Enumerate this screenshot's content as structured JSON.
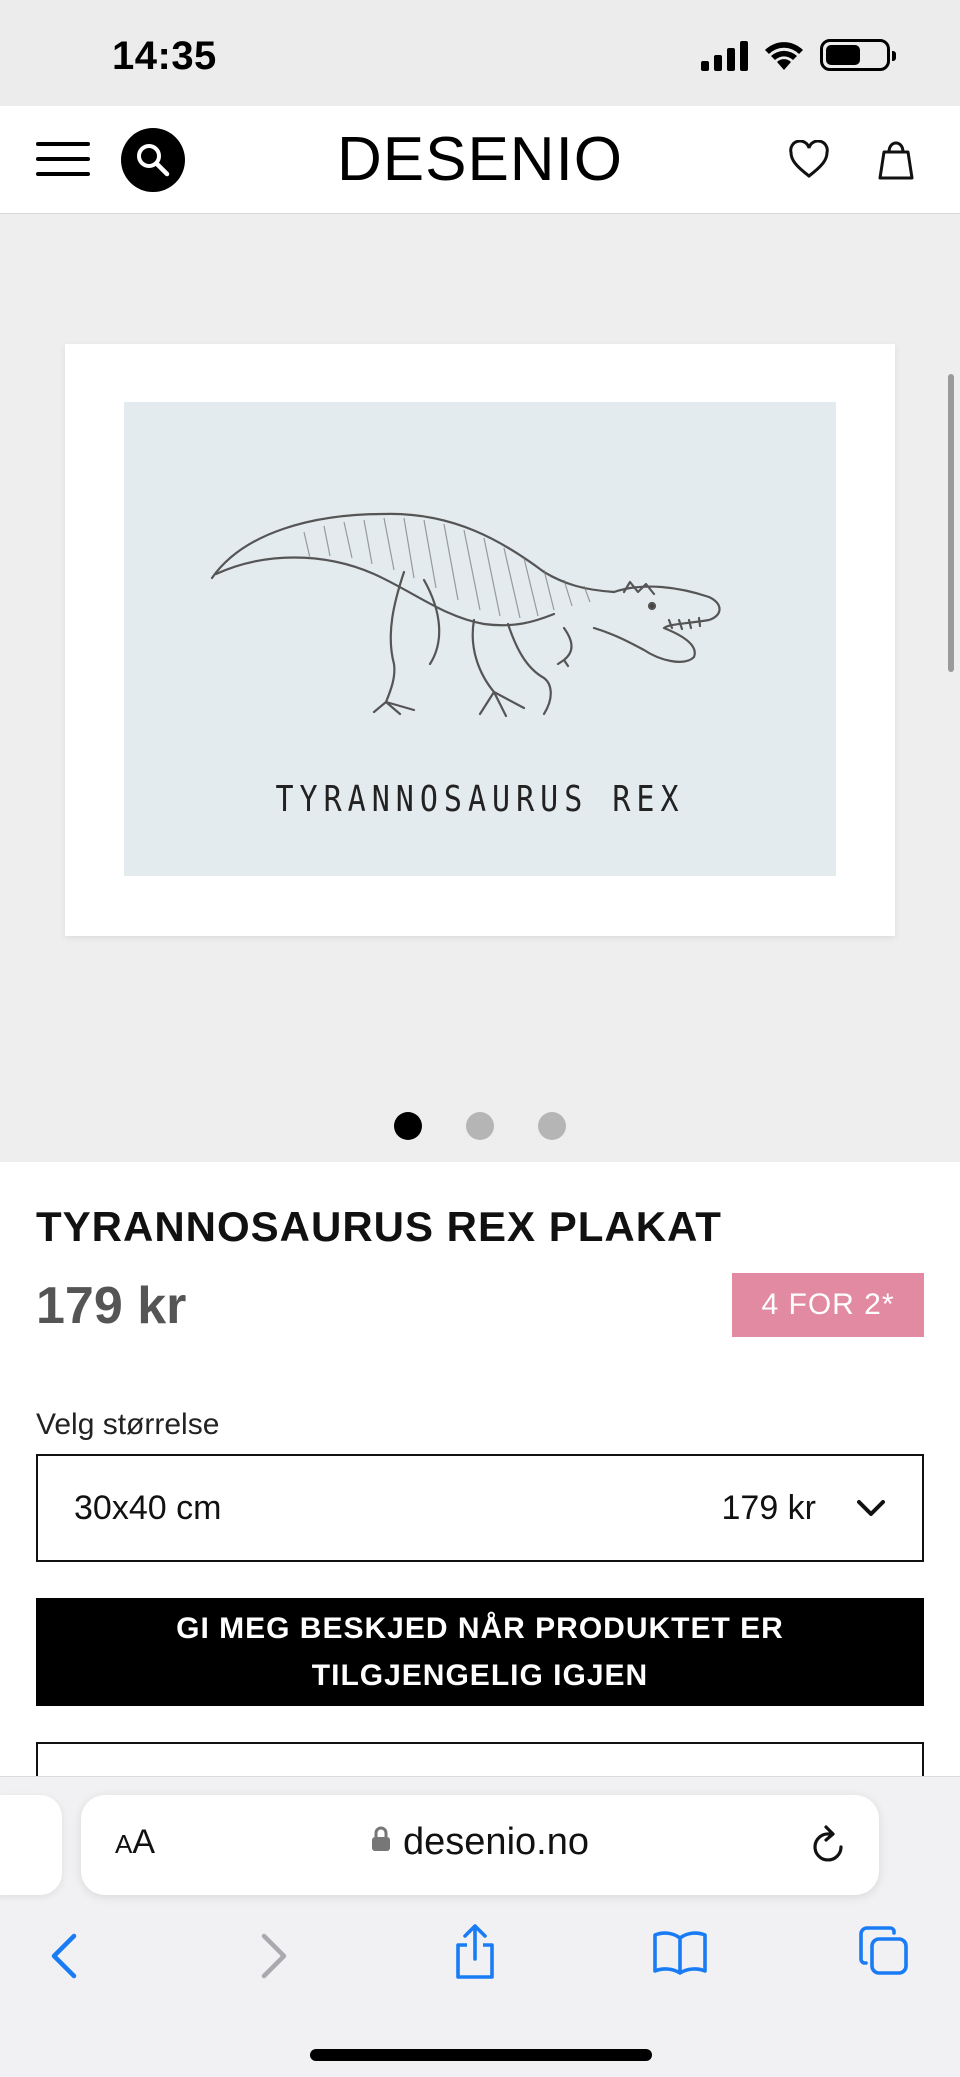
{
  "status_bar": {
    "time": "14:35"
  },
  "header": {
    "logo": "DESENIO",
    "icons": [
      "menu-icon",
      "search-icon",
      "heart-icon",
      "bag-icon"
    ]
  },
  "gallery": {
    "poster_caption": "TYRANNOSAURUS REX",
    "dots": [
      true,
      false,
      false
    ]
  },
  "product": {
    "title": "TYRANNOSAURUS REX PLAKAT",
    "price": "179 kr",
    "promo": "4 FOR 2*",
    "size_label": "Velg størrelse",
    "size_selected": "30x40 cm",
    "size_price": "179 kr",
    "notify_button": "GI MEG BESKJED NÅR PRODUKTET ER TILGJENGELIG IGJEN"
  },
  "browser": {
    "text_size_label_small": "A",
    "text_size_label_large": "A",
    "domain": "desenio.no",
    "toolbar": [
      "back-icon",
      "forward-icon",
      "share-icon",
      "bookmarks-icon",
      "tabs-icon"
    ]
  },
  "colors": {
    "promo_badge": "#e28aa1",
    "toolbar_blue": "#1a7cf5",
    "gallery_bg": "#eeeeee"
  }
}
